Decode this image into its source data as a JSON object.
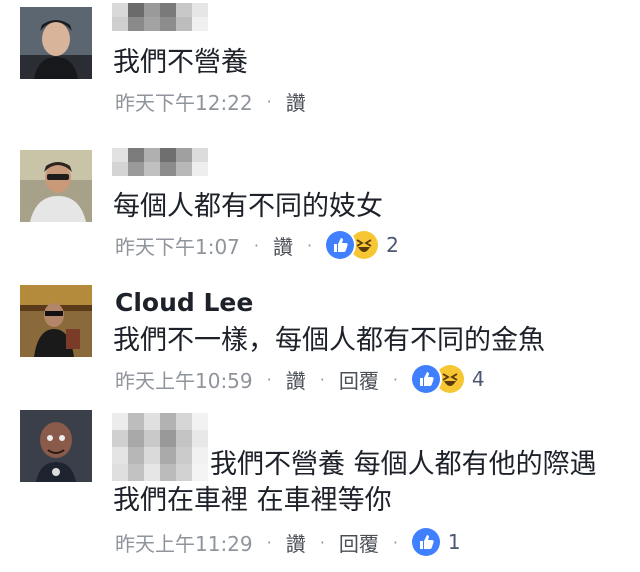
{
  "comments": [
    {
      "text": "我們不營養",
      "time": "昨天下午12:22",
      "like_label": "讚"
    },
    {
      "text": "每個人都有不同的妓女",
      "time": "昨天下午1:07",
      "like_label": "讚",
      "reaction_count": "2",
      "reactions": [
        "like-icon",
        "haha-icon"
      ]
    },
    {
      "name": "Cloud Lee",
      "text": "我們不一樣，每個人都有不同的金魚",
      "time": "昨天上午10:59",
      "like_label": "讚",
      "reply_label": "回覆",
      "reaction_count": "4",
      "reactions": [
        "like-icon",
        "haha-icon"
      ]
    },
    {
      "text_line1": "我們不營養 每個人都有他的際遇",
      "text_line2": "我們在車裡 在車裡等你",
      "time": "昨天上午11:29",
      "like_label": "讚",
      "reply_label": "回覆",
      "reaction_count": "1",
      "reactions": [
        "like-icon"
      ]
    }
  ],
  "colors": {
    "meta_text": "#90949c",
    "body_text": "#1d2129",
    "like_blue": "#4080ff",
    "haha_yellow": "#f7c633"
  },
  "separator": "·"
}
